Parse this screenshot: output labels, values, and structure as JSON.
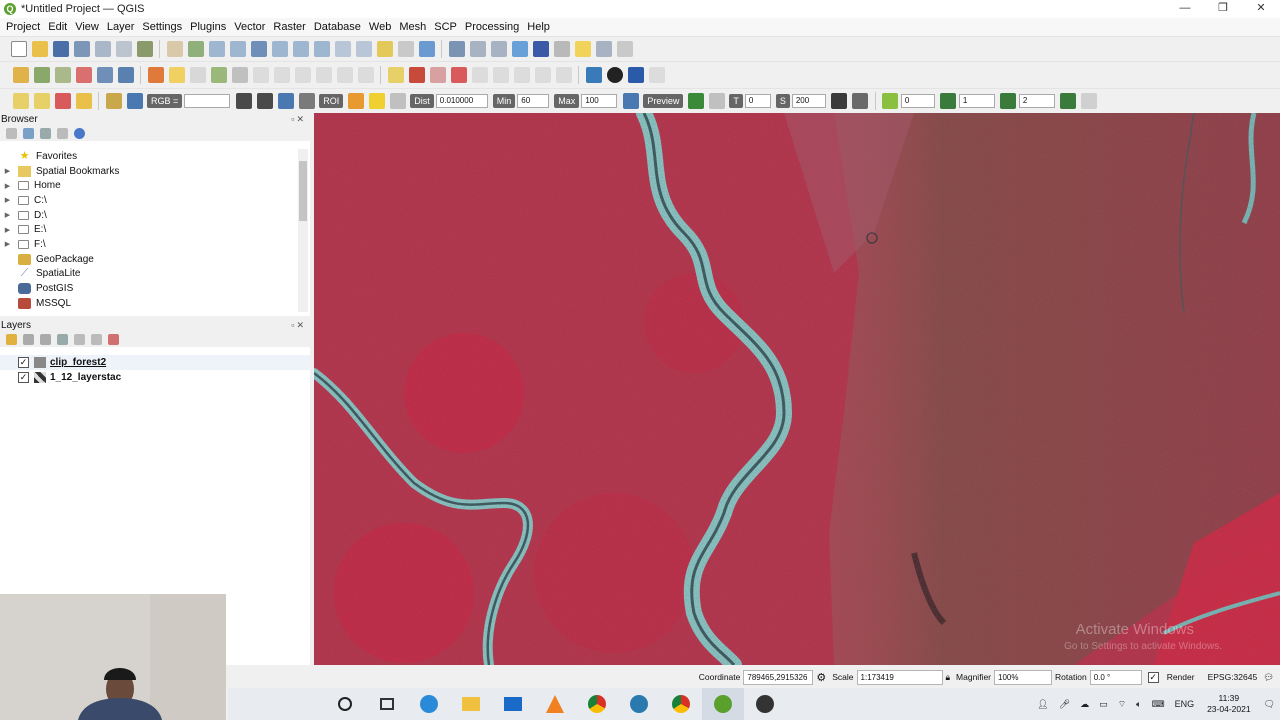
{
  "window": {
    "title": "*Untitled Project — QGIS",
    "app_icon_letter": "Q",
    "minimize_glyph": "—",
    "maximize_glyph": "❐",
    "close_glyph": "✕"
  },
  "menu": [
    "Project",
    "Edit",
    "View",
    "Layer",
    "Settings",
    "Plugins",
    "Vector",
    "Raster",
    "Database",
    "Web",
    "Mesh",
    "SCP",
    "Processing",
    "Help"
  ],
  "scp_toolbar": {
    "rgb_label": "RGB =",
    "roi_label": "ROI",
    "dist_label": "Dist",
    "dist_value": "0.010000",
    "min_label": "Min",
    "min_value": "60",
    "max_label": "Max",
    "max_value": "100",
    "preview_label": "Preview",
    "t_label": "T",
    "t_value": "0",
    "s_label": "S",
    "s_value": "200",
    "band_a": "0",
    "band_b": "1",
    "band_c": "2"
  },
  "browser": {
    "title": "Browser",
    "items": [
      {
        "label": "Favorites",
        "icon": "star-icon",
        "expandable": false
      },
      {
        "label": "Spatial Bookmarks",
        "icon": "bookmark-icon",
        "expandable": true
      },
      {
        "label": "Home",
        "icon": "folder-icon",
        "expandable": true
      },
      {
        "label": "C:\\",
        "icon": "folder-icon",
        "expandable": true
      },
      {
        "label": "D:\\",
        "icon": "folder-icon",
        "expandable": true
      },
      {
        "label": "E:\\",
        "icon": "folder-icon",
        "expandable": true
      },
      {
        "label": "F:\\",
        "icon": "folder-icon",
        "expandable": true
      },
      {
        "label": "GeoPackage",
        "icon": "geopackage-icon",
        "expandable": false
      },
      {
        "label": "SpatiaLite",
        "icon": "spatialite-icon",
        "expandable": false
      },
      {
        "label": "PostGIS",
        "icon": "postgis-icon",
        "expandable": false
      },
      {
        "label": "MSSQL",
        "icon": "mssql-icon",
        "expandable": false
      }
    ]
  },
  "layers": {
    "title": "Layers",
    "items": [
      {
        "label": "clip_forest2",
        "checked": "✓",
        "selected": true
      },
      {
        "label": "1_12_layerstac",
        "checked": "✓",
        "selected": false
      }
    ]
  },
  "statusbar": {
    "coordinate_label": "Coordinate",
    "coordinate_value": "789465,2915326",
    "scale_label": "Scale",
    "scale_value": "1:173419",
    "magnifier_label": "Magnifier",
    "magnifier_value": "100%",
    "rotation_label": "Rotation",
    "rotation_value": "0.0 °",
    "render_label": "Render",
    "render_checked": "✓",
    "crs_value": "EPSG:32645"
  },
  "watermark": {
    "line1": "Activate Windows",
    "line2": "Go to Settings to activate Windows."
  },
  "taskbar": {
    "language": "ENG",
    "time": "11:39",
    "date": "23-04-2021"
  },
  "colors": {
    "map_base": "#b4243a",
    "river": "#7fe0d8",
    "forest": "#7a4a3e",
    "accent_qgis": "#5aa02c"
  }
}
